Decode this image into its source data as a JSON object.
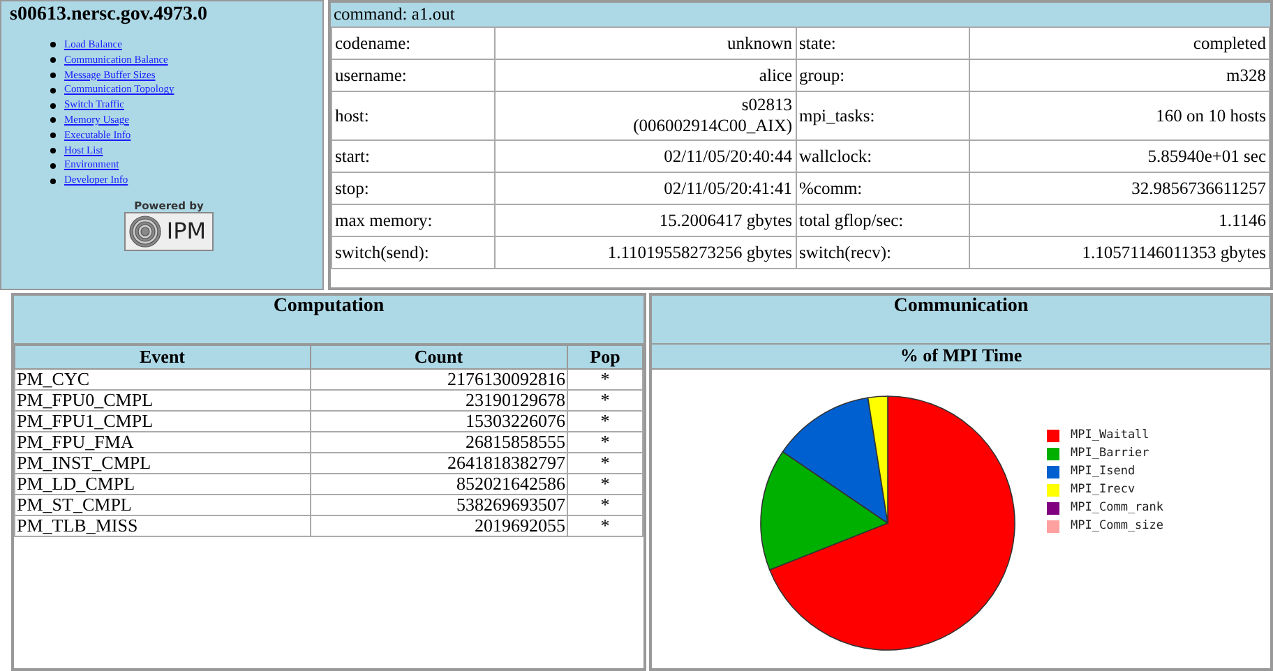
{
  "job": {
    "title": "s00613.nersc.gov.4973.0",
    "links": [
      "Load Balance",
      "Communication Balance",
      "Message Buffer Sizes",
      "Communication Topology",
      "Switch Traffic",
      "Memory Usage",
      "Executable Info",
      "Host List",
      "Environment",
      "Developer Info"
    ],
    "powered_by": "Powered by",
    "logo_text": "IPM"
  },
  "summary": {
    "command": "command: a1.out",
    "rows": [
      {
        "label": "codename:",
        "value": "unknown",
        "label_2": "state:",
        "value_2": "completed"
      },
      {
        "label": "username:",
        "value": "alice",
        "label_2": "group:",
        "value_2": "m328"
      },
      {
        "label": "host:",
        "value": "s02813\n(006002914C00_AIX)",
        "label_2": "mpi_tasks:",
        "value_2": "160 on 10 hosts"
      },
      {
        "label": "start:",
        "value": "02/11/05/20:40:44",
        "label_2": "wallclock:",
        "value_2": "5.85940e+01 sec"
      },
      {
        "label": "stop:",
        "value": "02/11/05/20:41:41",
        "label_2": "%comm:",
        "value_2": "32.9856736611257"
      },
      {
        "label": "max memory:",
        "value": "15.2006417 gbytes",
        "label_2": "total gflop/sec:",
        "value_2": "1.1146"
      },
      {
        "label": "switch(send):",
        "value": "1.11019558273256 gbytes",
        "label_2": "switch(recv):",
        "value_2": "1.10571146011353 gbytes"
      }
    ]
  },
  "computation": {
    "title": "Computation",
    "columns": [
      "Event",
      "Count",
      "Pop"
    ],
    "rows": [
      [
        "PM_CYC",
        "2176130092816",
        "*"
      ],
      [
        "PM_FPU0_CMPL",
        "23190129678",
        "*"
      ],
      [
        "PM_FPU1_CMPL",
        "15303226076",
        "*"
      ],
      [
        "PM_FPU_FMA",
        "26815858555",
        "*"
      ],
      [
        "PM_INST_CMPL",
        "2641818382797",
        "*"
      ],
      [
        "PM_LD_CMPL",
        "852021642586",
        "*"
      ],
      [
        "PM_ST_CMPL",
        "538269693507",
        "*"
      ],
      [
        "PM_TLB_MISS",
        "2019692055",
        "*"
      ]
    ]
  },
  "communication": {
    "title": "Communication",
    "subtitle": "% of MPI Time",
    "legend": [
      {
        "name": "MPI_Waitall",
        "color": "#ff0000"
      },
      {
        "name": "MPI_Barrier",
        "color": "#00b000"
      },
      {
        "name": "MPI_Isend",
        "color": "#0060d0"
      },
      {
        "name": "MPI_Irecv",
        "color": "#ffff00"
      },
      {
        "name": "MPI_Comm_rank",
        "color": "#800080"
      },
      {
        "name": "MPI_Comm_size",
        "color": "#ffa0a0"
      }
    ]
  }
}
